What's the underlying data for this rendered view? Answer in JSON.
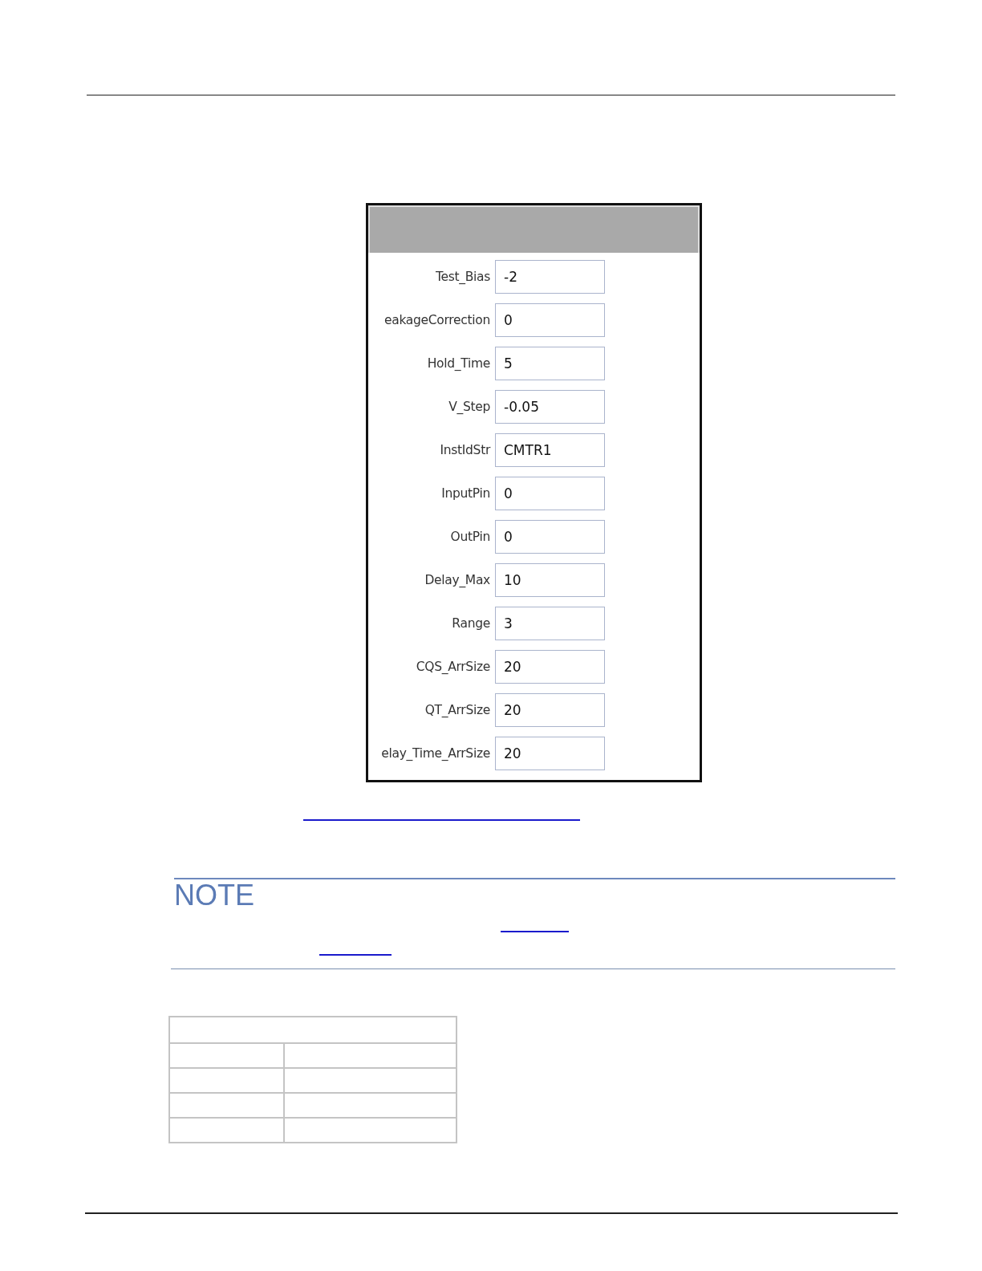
{
  "parameters": [
    {
      "label": "Test_Bias",
      "value": "-2"
    },
    {
      "label": "eakageCorrection",
      "value": "0"
    },
    {
      "label": "Hold_Time",
      "value": "5"
    },
    {
      "label": "V_Step",
      "value": "-0.05"
    },
    {
      "label": "InstIdStr",
      "value": "CMTR1"
    },
    {
      "label": "InputPin",
      "value": "0"
    },
    {
      "label": "OutPin",
      "value": "0"
    },
    {
      "label": "Delay_Max",
      "value": "10"
    },
    {
      "label": "Range",
      "value": "3"
    },
    {
      "label": "CQS_ArrSize",
      "value": "20"
    },
    {
      "label": "QT_ArrSize",
      "value": "20"
    },
    {
      "label": "elay_Time_ArrSize",
      "value": "20"
    }
  ],
  "note": {
    "title": "NOTE"
  }
}
